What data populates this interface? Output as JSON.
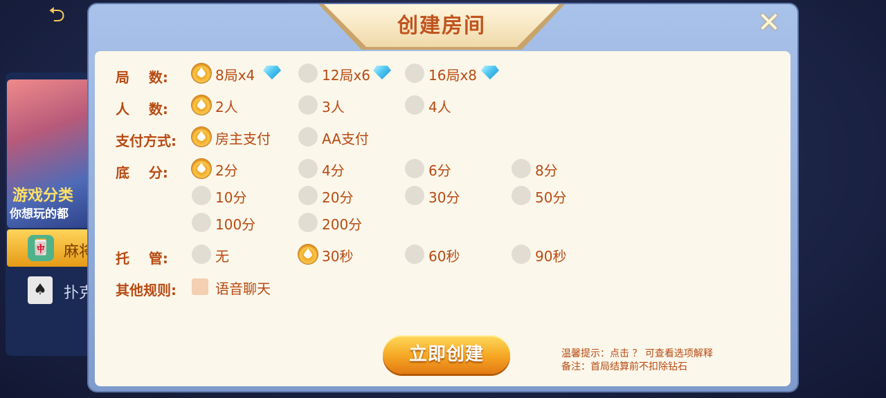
{
  "background": {
    "banner_title": "游戏分类",
    "banner_subtitle": "你想玩的都",
    "tab1_label": "麻将",
    "tab2_label": "扑克"
  },
  "modal": {
    "title": "创建房间",
    "close_icon": "close-icon"
  },
  "rows": {
    "rounds_label": "局    数:",
    "players_label": "人    数:",
    "payment_label": "支付方式:",
    "base_label": "底    分:",
    "trustee_label": "托    管:",
    "other_label": "其他规则:"
  },
  "rounds": [
    {
      "label": "8局x4",
      "selected": true,
      "icon": "diamond-icon"
    },
    {
      "label": "12局x6",
      "selected": false,
      "icon": "diamond-icon"
    },
    {
      "label": "16局x8",
      "selected": false,
      "icon": "diamond-icon"
    }
  ],
  "players": [
    {
      "label": "2人",
      "selected": true
    },
    {
      "label": "3人",
      "selected": false
    },
    {
      "label": "4人",
      "selected": false
    }
  ],
  "payment": [
    {
      "label": "房主支付",
      "selected": true
    },
    {
      "label": "AA支付",
      "selected": false
    }
  ],
  "base_score": [
    {
      "label": "2分",
      "selected": true
    },
    {
      "label": "4分",
      "selected": false
    },
    {
      "label": "6分",
      "selected": false
    },
    {
      "label": "8分",
      "selected": false
    },
    {
      "label": "10分",
      "selected": false
    },
    {
      "label": "20分",
      "selected": false
    },
    {
      "label": "30分",
      "selected": false
    },
    {
      "label": "50分",
      "selected": false
    },
    {
      "label": "100分",
      "selected": false
    },
    {
      "label": "200分",
      "selected": false
    }
  ],
  "trustee": [
    {
      "label": "无",
      "selected": false
    },
    {
      "label": "30秒",
      "selected": true
    },
    {
      "label": "60秒",
      "selected": false
    },
    {
      "label": "90秒",
      "selected": false
    }
  ],
  "other_rules": [
    {
      "label": "语音聊天",
      "checked": false
    }
  ],
  "create_button": "立即创建",
  "tips": {
    "line1": "温馨提示：点击 ？ 可查看选项解释",
    "line2": "备注：首局结算前不扣除钻石"
  },
  "colors": {
    "accent_text": "#b84a12",
    "button_orange": "#f5a623",
    "panel_bg": "#fbf7eb"
  }
}
